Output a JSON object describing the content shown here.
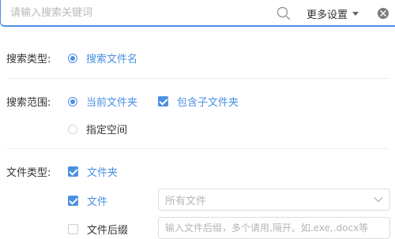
{
  "search": {
    "placeholder": "请输入搜索关键词",
    "value": ""
  },
  "header": {
    "more_settings_label": "更多设置",
    "icons": {
      "search": "search-icon",
      "caret": "caret-down-icon",
      "close": "close-icon"
    }
  },
  "colors": {
    "accent": "#4a90e2",
    "divider": "#ececec"
  },
  "search_type": {
    "label": "搜索类型:",
    "options": [
      {
        "label": "搜索文件名",
        "selected": true
      }
    ]
  },
  "search_scope": {
    "label": "搜索范围:",
    "options": [
      {
        "label": "当前文件夹",
        "selected": true
      },
      {
        "label": "包含子文件夹",
        "checked": true
      },
      {
        "label": "指定空间",
        "selected": false
      }
    ]
  },
  "file_type": {
    "label": "文件类型:",
    "options": [
      {
        "label": "文件夹",
        "checked": true
      },
      {
        "label": "文件",
        "checked": true
      },
      {
        "label": "文件后缀",
        "checked": false
      }
    ],
    "file_select": {
      "value": "所有文件"
    },
    "suffix_input": {
      "placeholder": "输入文件后缀，多个请用,隔开。如.exe,.docx等",
      "value": ""
    }
  }
}
